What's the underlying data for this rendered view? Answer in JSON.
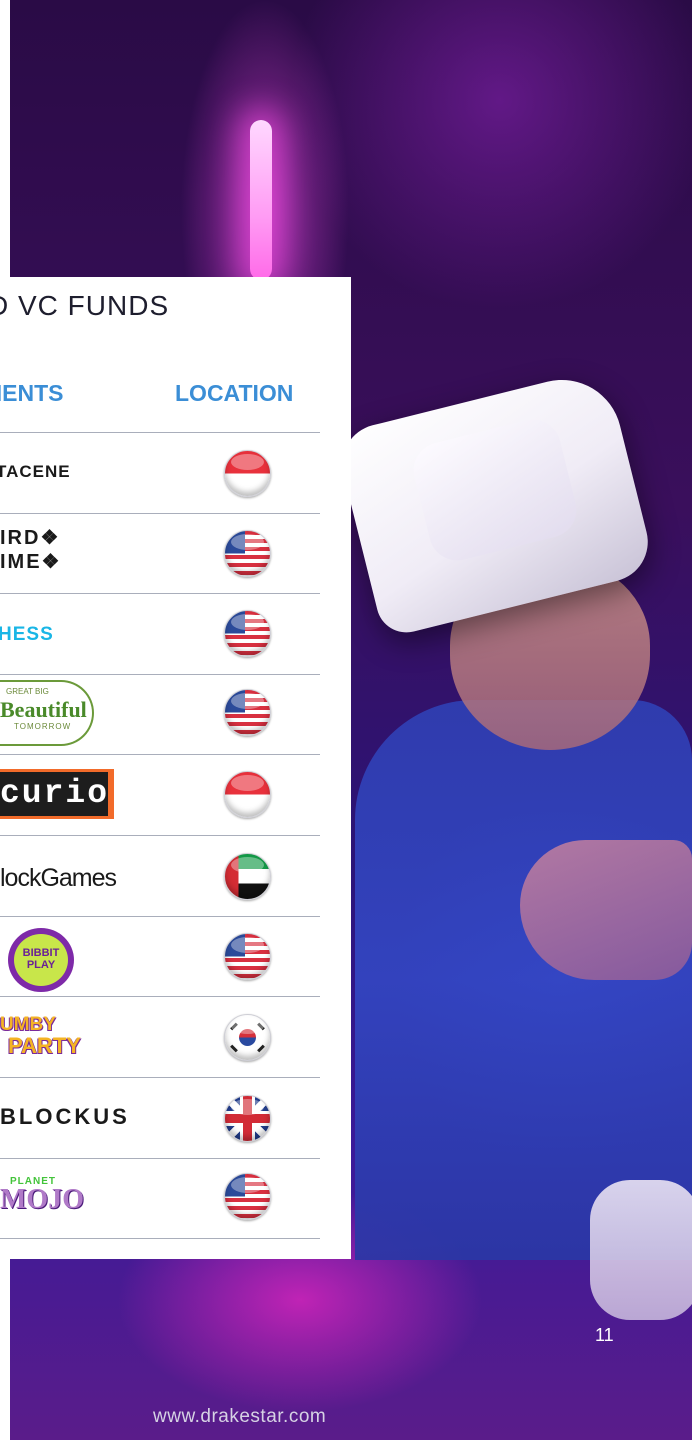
{
  "panel": {
    "title": "D VC FUNDS",
    "columns": {
      "investments": "MENTS",
      "location": "LOCATION"
    }
  },
  "rows": [
    {
      "logo_text": "TACENE",
      "flag": "flag-singapore"
    },
    {
      "logo_text": "IRD❖\nIME❖",
      "flag": "flag-united-states"
    },
    {
      "logo_text": "HESS",
      "flag": "flag-united-states"
    },
    {
      "logo_text": "Beautiful",
      "logo_small_top": "GREAT BIG",
      "logo_small_bottom": "TOMORROW",
      "flag": "flag-united-states"
    },
    {
      "logo_text": "curio",
      "flag": "flag-singapore"
    },
    {
      "logo_text": "lockGames",
      "flag": "flag-united-arab-emirates"
    },
    {
      "logo_text": "BIBBIT PLAY",
      "flag": "flag-united-states"
    },
    {
      "logo_text": "UMBY",
      "logo_text_2": "PARTY",
      "flag": "flag-south-korea"
    },
    {
      "logo_text": "BLOCKUS",
      "flag": "flag-united-kingdom"
    },
    {
      "logo_text": "MOJO",
      "logo_small_top": "PLANET",
      "flag": "flag-united-states"
    }
  ],
  "page_number": "11",
  "footer_url": "www.drakestar.com",
  "colors": {
    "accent_blue": "#3b8ed6",
    "text_dark": "#1e1e2e",
    "divider": "#a9aebb"
  }
}
